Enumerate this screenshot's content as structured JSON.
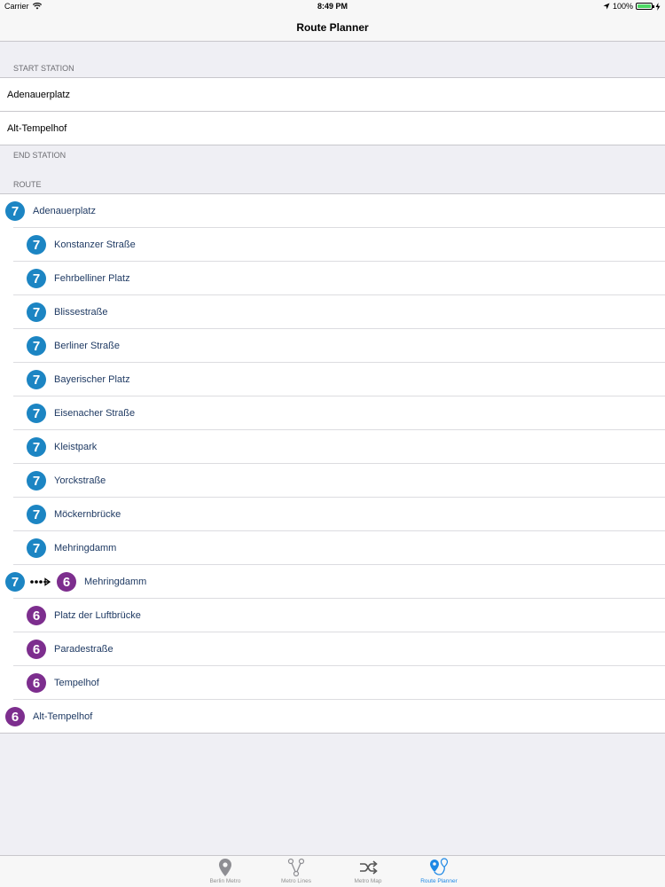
{
  "status_bar": {
    "carrier": "Carrier",
    "time": "8:49 PM",
    "battery": "100%",
    "battery_color": "#4cd964"
  },
  "nav": {
    "title": "Route Planner"
  },
  "start_station": {
    "header": "START STATION",
    "value": "Adenauerplatz"
  },
  "end_station": {
    "header": "END STATION",
    "value": "Alt-Tempelhof"
  },
  "route": {
    "header": "ROUTE",
    "line_colors": {
      "7": "#1c85c3",
      "6": "#7d2e8e"
    },
    "stops": [
      {
        "line": "7",
        "name": "Adenauerplatz"
      },
      {
        "line": "7",
        "name": "Konstanzer Straße"
      },
      {
        "line": "7",
        "name": "Fehrbelliner Platz"
      },
      {
        "line": "7",
        "name": "Blissestraße"
      },
      {
        "line": "7",
        "name": "Berliner Straße"
      },
      {
        "line": "7",
        "name": "Bayerischer Platz"
      },
      {
        "line": "7",
        "name": "Eisenacher Straße"
      },
      {
        "line": "7",
        "name": "Kleistpark"
      },
      {
        "line": "7",
        "name": "Yorckstraße"
      },
      {
        "line": "7",
        "name": "Möckernbrücke"
      },
      {
        "line": "7",
        "name": "Mehringdamm"
      },
      {
        "line": "6",
        "from_line": "7",
        "name": "Mehringdamm"
      },
      {
        "line": "6",
        "name": "Platz der Luftbrücke"
      },
      {
        "line": "6",
        "name": "Paradestraße"
      },
      {
        "line": "6",
        "name": "Tempelhof"
      },
      {
        "line": "6",
        "name": "Alt-Tempelhof"
      }
    ]
  },
  "tab_bar": {
    "active_color": "#1e88e5",
    "tabs": [
      {
        "label": "Berlin Metro",
        "icon": "map-pin-icon"
      },
      {
        "label": "Metro Lines",
        "icon": "metro-lines-icon"
      },
      {
        "label": "Metro Map",
        "icon": "shuffle-icon"
      },
      {
        "label": "Route Planner",
        "icon": "route-planner-icon"
      }
    ]
  }
}
